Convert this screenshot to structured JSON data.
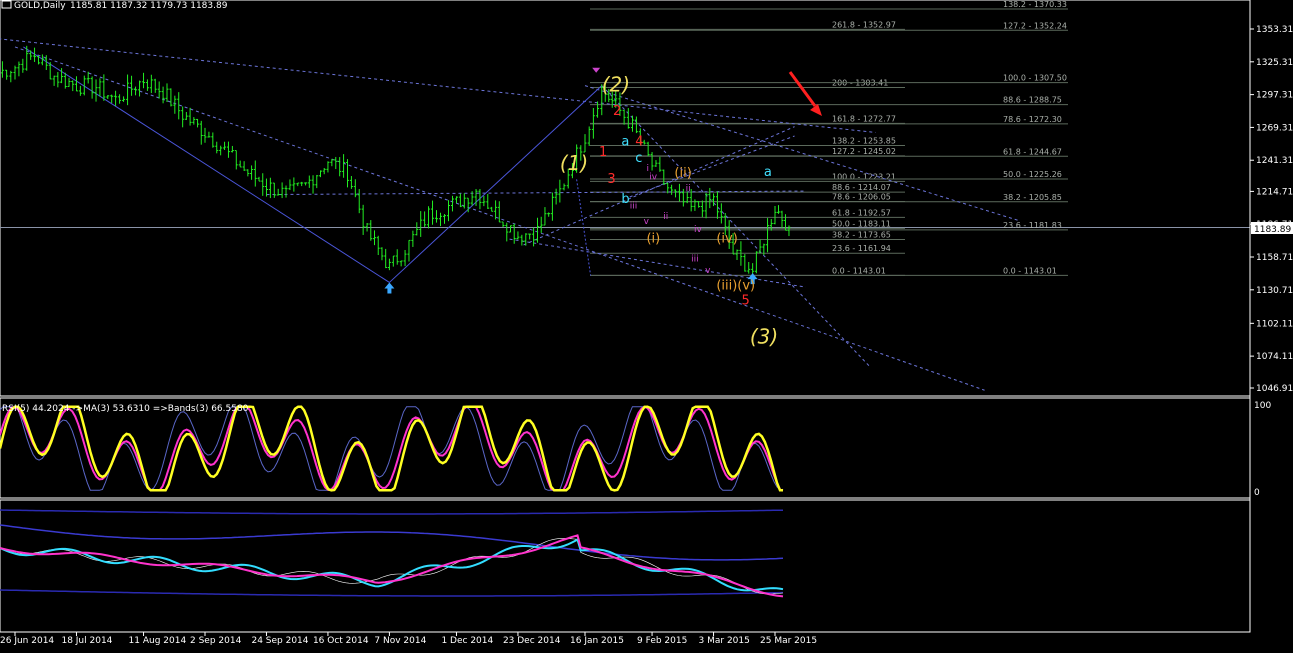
{
  "header": {
    "symbol": "GOLD,Daily",
    "ohlc": "1185.81 1187.32 1179.73 1183.89"
  },
  "current_price": "1183.89",
  "price_axis": [
    "1353.31",
    "1325.31",
    "1297.31",
    "1269.31",
    "1241.31",
    "1214.71",
    "1186.71",
    "1158.71",
    "1130.71",
    "1102.11",
    "1074.11",
    "1046.91"
  ],
  "date_axis": [
    "26 Jun 2014",
    "18 Jul 2014",
    "11 Aug 2014",
    "2 Sep 2014",
    "24 Sep 2014",
    "16 Oct 2014",
    "7 Nov 2014",
    "1 Dec 2014",
    "23 Dec 2014",
    "16 Jan 2015",
    "9 Feb 2015",
    "3 Mar 2015",
    "25 Mar 2015"
  ],
  "fib_levels_left": [
    {
      "label": "261.8 - 1352.97",
      "price": 1352.97
    },
    {
      "label": "200 - 1303.41",
      "price": 1303.41
    },
    {
      "label": "161.8 - 1272.77",
      "price": 1272.77
    },
    {
      "label": "138.2 - 1253.85",
      "price": 1253.85
    },
    {
      "label": "127.2 - 1245.02",
      "price": 1245.02
    },
    {
      "label": "100.0 - 1223.21",
      "price": 1223.21
    },
    {
      "label": "88.6 - 1214.07",
      "price": 1214.07
    },
    {
      "label": "78.6 - 1206.05",
      "price": 1206.05
    },
    {
      "label": "61.8 - 1192.57",
      "price": 1192.57
    },
    {
      "label": "50.0 - 1183.11",
      "price": 1183.11
    },
    {
      "label": "38.2 - 1173.65",
      "price": 1173.65
    },
    {
      "label": "23.6 - 1161.94",
      "price": 1161.94
    },
    {
      "label": "0.0 - 1143.01",
      "price": 1143.01
    }
  ],
  "fib_levels_right": [
    {
      "label": "138.2 - 1370.33",
      "price": 1370.33
    },
    {
      "label": "127.2 - 1352.24",
      "price": 1352.24
    },
    {
      "label": "100.0 - 1307.50",
      "price": 1307.5
    },
    {
      "label": "88.6 - 1288.75",
      "price": 1288.75
    },
    {
      "label": "78.6 - 1272.30",
      "price": 1272.3
    },
    {
      "label": "61.8 - 1244.67",
      "price": 1244.67
    },
    {
      "label": "50.0 - 1225.26",
      "price": 1225.26
    },
    {
      "label": "38.2 - 1205.85",
      "price": 1205.85
    },
    {
      "label": "23.6 - 1181.83",
      "price": 1181.83
    },
    {
      "label": "0.0 - 1143.01",
      "price": 1143.01
    }
  ],
  "wave_labels": [
    {
      "text": "(2)",
      "color": "#f0e060",
      "price": 1300,
      "date": "2015-01-22"
    },
    {
      "text": "(1)",
      "color": "#f0e060",
      "price": 1233,
      "date": "2015-01-07"
    },
    {
      "text": "(3)",
      "color": "#f0e060",
      "price": 1085,
      "date": "2015-03-16"
    },
    {
      "text": "2",
      "color": "#ff2a2a",
      "price": 1280,
      "date": "2015-01-26"
    },
    {
      "text": "1",
      "color": "#ff2a2a",
      "price": 1245,
      "date": "2015-01-21"
    },
    {
      "text": "4",
      "color": "#ff2a2a",
      "price": 1254,
      "date": "2015-02-03"
    },
    {
      "text": "3",
      "color": "#ff2a2a",
      "price": 1222,
      "date": "2015-01-24"
    },
    {
      "text": "5",
      "color": "#ff2a2a",
      "price": 1118,
      "date": "2015-03-13"
    },
    {
      "text": "a",
      "color": "#40e0ff",
      "price": 1254,
      "date": "2015-01-29"
    },
    {
      "text": "c",
      "color": "#40e0ff",
      "price": 1240,
      "date": "2015-02-03"
    },
    {
      "text": "b",
      "color": "#40e0ff",
      "price": 1205,
      "date": "2015-01-29"
    },
    {
      "text": "a",
      "color": "#40e0ff",
      "price": 1228,
      "date": "2015-03-21"
    },
    {
      "text": "(ii)",
      "color": "#e8a030",
      "price": 1227,
      "date": "2015-02-17"
    },
    {
      "text": "(i)",
      "color": "#e8a030",
      "price": 1171,
      "date": "2015-02-07"
    },
    {
      "text": "(iv)",
      "color": "#e8a030",
      "price": 1171,
      "date": "2015-03-04"
    },
    {
      "text": "(iii)(v)",
      "color": "#e8a030",
      "price": 1131,
      "date": "2015-03-04"
    },
    {
      "text": "iii",
      "color": "#cc44cc",
      "price": 1200,
      "date": "2015-02-01"
    },
    {
      "text": "iv",
      "color": "#cc44cc",
      "price": 1225,
      "date": "2015-02-08"
    },
    {
      "text": "v",
      "color": "#cc44cc",
      "price": 1187,
      "date": "2015-02-06"
    },
    {
      "text": "ii",
      "color": "#cc44cc",
      "price": 1215,
      "date": "2015-02-21"
    },
    {
      "text": "iv",
      "color": "#cc44cc",
      "price": 1180,
      "date": "2015-02-24"
    },
    {
      "text": "iii",
      "color": "#cc44cc",
      "price": 1155,
      "date": "2015-02-23"
    },
    {
      "text": "v",
      "color": "#cc44cc",
      "price": 1145,
      "date": "2015-02-28"
    },
    {
      "text": "i",
      "color": "#cc44cc",
      "price": 1232,
      "date": "2015-02-07"
    },
    {
      "text": "ii",
      "color": "#cc44cc",
      "price": 1191,
      "date": "2015-02-13"
    }
  ],
  "rsi_panel": {
    "title": "RSI(5) 44.2024  ->MA(3) 53.6310  =>Bands(3) 66.5580",
    "ticks": [
      "100",
      "0"
    ]
  },
  "chart_data": {
    "type": "line",
    "title": "GOLD,Daily",
    "ylim": [
      1040,
      1375
    ],
    "series": [
      {
        "name": "GOLD,Daily",
        "x": [
          "2014-06-20",
          "2014-06-26",
          "2014-07-03",
          "2014-07-10",
          "2014-07-18",
          "2014-07-25",
          "2014-08-01",
          "2014-08-11",
          "2014-08-18",
          "2014-08-25",
          "2014-09-02",
          "2014-09-09",
          "2014-09-16",
          "2014-09-24",
          "2014-10-01",
          "2014-10-08",
          "2014-10-16",
          "2014-10-23",
          "2014-10-30",
          "2014-11-07",
          "2014-11-14",
          "2014-11-21",
          "2014-12-01",
          "2014-12-08",
          "2014-12-15",
          "2014-12-23",
          "2014-12-30",
          "2015-01-07",
          "2015-01-16",
          "2015-01-22",
          "2015-01-27",
          "2015-02-02",
          "2015-02-09",
          "2015-02-16",
          "2015-02-23",
          "2015-03-03",
          "2015-03-10",
          "2015-03-17",
          "2015-03-25",
          "2015-03-30"
        ],
        "values": [
          1316,
          1321,
          1331,
          1313,
          1305,
          1304,
          1293,
          1310,
          1300,
          1280,
          1265,
          1250,
          1233,
          1220,
          1212,
          1220,
          1241,
          1231,
          1180,
          1150,
          1170,
          1195,
          1205,
          1215,
          1197,
          1177,
          1181,
          1215,
          1262,
          1302,
          1288,
          1270,
          1237,
          1213,
          1200,
          1208,
          1162,
          1147,
          1201,
          1184
        ]
      }
    ]
  }
}
